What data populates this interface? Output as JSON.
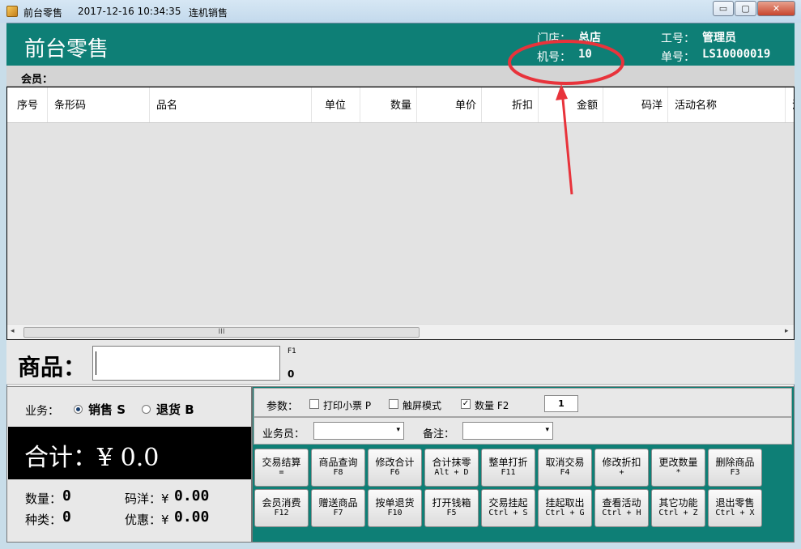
{
  "window": {
    "app_title": "前台零售",
    "datetime": "2017-12-16 10:34:35",
    "mode": "连机销售",
    "min_glyph": "▭",
    "max_glyph": "▢",
    "close_glyph": "✕"
  },
  "header": {
    "title": "前台零售",
    "store_label": "门店：",
    "store_value": "总店",
    "machine_label": "机号：",
    "machine_value": "10",
    "staff_label": "工号：",
    "staff_value": "管理员",
    "order_label": "单号：",
    "order_value": "LS10000019"
  },
  "member": {
    "label": "会员："
  },
  "grid": {
    "columns": [
      "序号",
      "条形码",
      "品名",
      "单位",
      "数量",
      "单价",
      "折扣",
      "金额",
      "码洋",
      "活动名称",
      "活"
    ],
    "rows": [],
    "scroll_thumb": "III",
    "scroll_left": "◂",
    "scroll_right": "▸"
  },
  "product": {
    "label": "商品：",
    "input_value": "",
    "hotkey": "F1",
    "qty": "0"
  },
  "business": {
    "label": "业务：",
    "option_sale": "销售 S",
    "option_return": "退货 B",
    "selected": "销售 S"
  },
  "totals": {
    "total_label": "合计：",
    "total_value": "¥ 0.0",
    "qty_label": "数量：",
    "qty_value": "0",
    "kinds_label": "种类：",
    "kinds_value": "0",
    "list_label": "码洋：¥",
    "list_value": "0.00",
    "discount_label": "优惠：¥",
    "discount_value": "0.00"
  },
  "params": {
    "label": "参数：",
    "print_receipt": "打印小票 P",
    "touch_mode": "触屏模式",
    "quantity": "数量 F2",
    "quantity_value": "1",
    "print_checked": false,
    "touch_checked": false,
    "quantity_checked": true,
    "check_glyph": "✓"
  },
  "clerk": {
    "label": "业务员：",
    "value": "",
    "note_label": "备注：",
    "note_value": "",
    "dropdown_glyph": "▾"
  },
  "buttons": [
    {
      "label": "交易结算",
      "key": "="
    },
    {
      "label": "商品查询",
      "key": "F8"
    },
    {
      "label": "修改合计",
      "key": "F6"
    },
    {
      "label": "合计抹零",
      "key": "Alt + D"
    },
    {
      "label": "整单打折",
      "key": "F11"
    },
    {
      "label": "取消交易",
      "key": "F4"
    },
    {
      "label": "修改折扣",
      "key": "+"
    },
    {
      "label": "更改数量",
      "key": "*"
    },
    {
      "label": "删除商品",
      "key": "F3"
    },
    {
      "label": "会员消费",
      "key": "F12"
    },
    {
      "label": "赠送商品",
      "key": "F7"
    },
    {
      "label": "按单退货",
      "key": "F10"
    },
    {
      "label": "打开钱箱",
      "key": "F5"
    },
    {
      "label": "交易挂起",
      "key": "Ctrl + S"
    },
    {
      "label": "挂起取出",
      "key": "Ctrl + G"
    },
    {
      "label": "查看活动",
      "key": "Ctrl + H"
    },
    {
      "label": "其它功能",
      "key": "Ctrl + Z"
    },
    {
      "label": "退出零售",
      "key": "Ctrl + X"
    }
  ],
  "colors": {
    "teal": "#0e7f76",
    "annotation": "#e8333b"
  }
}
